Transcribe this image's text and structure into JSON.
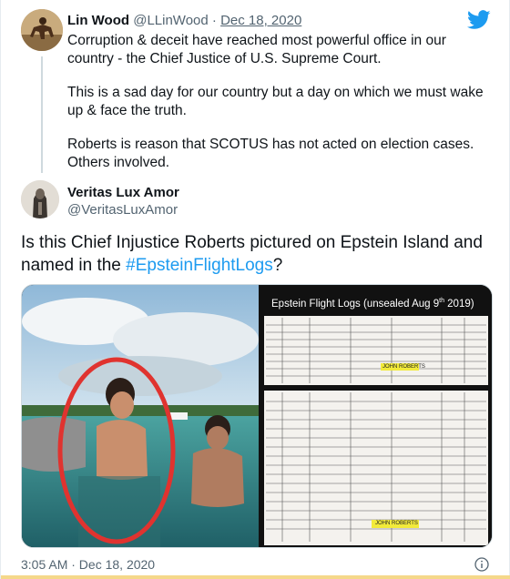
{
  "parent_tweet": {
    "name": "Lin Wood",
    "handle": "@LLinWood",
    "separator": "·",
    "date": "Dec 18, 2020",
    "paragraphs": [
      "Corruption & deceit have reached most powerful office in our country - the Chief Justice of U.S. Supreme Court.",
      "This is a sad day for our country but a day on which we must wake up & face the truth.",
      "Roberts is reason that SCOTUS has not acted on election cases. Others involved."
    ]
  },
  "quoted_tweet": {
    "name": "Veritas Lux Amor",
    "handle": "@VeritasLuxAmor",
    "text_before": "Is this Chief Injustice Roberts pictured on Epstein Island and named in the ",
    "hashtag": "#EpsteinFlightLogs",
    "text_after": "?",
    "media": {
      "doc_title_prefix": "Epstein Flight Logs (unsealed Aug  9",
      "doc_title_sup": "th",
      "doc_title_suffix": " 2019)",
      "highlighted_entries": [
        "JOHN ROBERTS",
        "JOHN ROBERTS"
      ]
    }
  },
  "footer": {
    "time": "3:05 AM · Dec 18, 2020"
  },
  "icons": {
    "brand": "twitter-bird-icon",
    "info": "info-icon"
  },
  "colors": {
    "accent": "#1d9bf0",
    "text": "#0f1419",
    "muted": "#536471",
    "highlight": "#f2ea3a",
    "circle": "#e0332f"
  }
}
